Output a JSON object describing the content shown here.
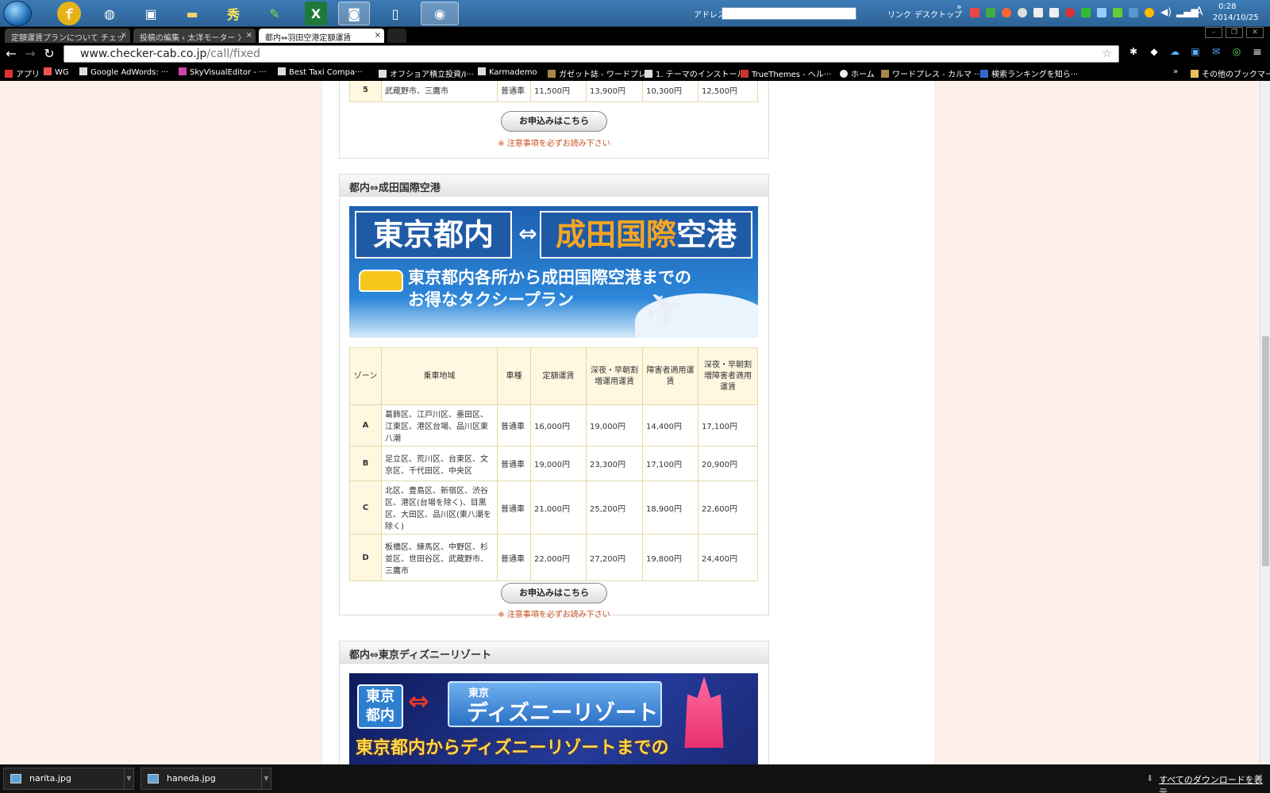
{
  "system": {
    "address_label": "アドレス",
    "links_label": "リンク",
    "desktop_label": "デスクトップ",
    "chevron": "»",
    "ime": "A",
    "clock_time": "0:28",
    "clock_date": "2014/10/25",
    "taskbar_apps": [
      "fm-icon",
      "globe-icon",
      "windows-icon",
      "folder-icon",
      "hidemaru-icon",
      "editor-icon",
      "excel-icon",
      "camera-icon",
      "document-icon",
      "chrome-icon"
    ]
  },
  "browser": {
    "tabs": [
      {
        "label": "定額運賃プランについて チェッ"
      },
      {
        "label": "投稿の編集 ‹ 太洋モーター 〉"
      },
      {
        "label": "都内⇔羽田空港定額運賃"
      }
    ],
    "url_host": "www.checker-cab.co.jp",
    "url_path": "/call/fixed",
    "bookmarks": [
      "アプリ",
      "WG",
      "Google AdWords: ···",
      "SkyVisualEditor - ···",
      "Best Taxi Compa···",
      "オフショア積立投資/I···",
      "Karmademo",
      "ガゼット誌 - ワードプレ···",
      "1. テーマのインストール",
      "TrueThemes - ヘル···",
      "ホーム",
      "ワードプレス - カルマ ···",
      "検索ランキングを知ら···"
    ],
    "bookmarks_more": "»",
    "other_bookmarks": "その他のブックマーク"
  },
  "top_table": {
    "row": {
      "zone": "5",
      "area": "武蔵野市、三鷹市",
      "car": "普通車",
      "fixed": "11,500円",
      "late": "13,900円",
      "disabled": "10,300円",
      "late_disabled": "12,500円"
    }
  },
  "apply_label": "お申込みはこちら",
  "note": "※ 注意事項を必ずお読み下さい",
  "narita": {
    "heading": "都内⇔成田国際空港",
    "banner_left": "東京都内",
    "banner_arrow": "⇔",
    "banner_right_1": "成田国際",
    "banner_right_2": "空港",
    "banner_sub1": "東京都内各所から成田国際空港までの",
    "banner_sub2": "お得なタクシープラン",
    "headers": [
      "ゾーン",
      "乗車地域",
      "車種",
      "定額運賃",
      "深夜・早朝割増運用運賃",
      "障害者適用運賃",
      "深夜・早朝割増障害者適用運賃"
    ],
    "rows": [
      {
        "zone": "A",
        "area": "葛飾区、江戸川区、墨田区、江東区、港区台場、品川区東八潮",
        "car": "普通車",
        "fixed": "16,000円",
        "late": "19,000円",
        "disabled": "14,400円",
        "late_disabled": "17,100円"
      },
      {
        "zone": "B",
        "area": "足立区、荒川区、台東区、文京区、千代田区、中央区",
        "car": "普通車",
        "fixed": "19,000円",
        "late": "23,300円",
        "disabled": "17,100円",
        "late_disabled": "20,900円"
      },
      {
        "zone": "C",
        "area": "北区、豊島区、新宿区、渋谷区、港区(台場を除く)、目黒区、大田区、品川区(東八潮を除く)",
        "car": "普通車",
        "fixed": "21,000円",
        "late": "25,200円",
        "disabled": "18,900円",
        "late_disabled": "22,600円"
      },
      {
        "zone": "D",
        "area": "板橋区、練馬区、中野区、杉並区、世田谷区、武蔵野市、三鷹市",
        "car": "普通車",
        "fixed": "22,000円",
        "late": "27,200円",
        "disabled": "19,800円",
        "late_disabled": "24,400円"
      }
    ]
  },
  "disney": {
    "heading": "都内⇔東京ディズニーリゾート",
    "banner_left_1": "東京",
    "banner_left_2": "都内",
    "banner_arrow": "⇔",
    "banner_right_small": "東京",
    "banner_right_big": "ディズニーリゾート",
    "banner_sub": "東京都内からディズニーリゾートまでの"
  },
  "downloads": {
    "items": [
      {
        "label": "narita.jpg"
      },
      {
        "label": "haneda.jpg"
      }
    ],
    "show_all": "すべてのダウンロードを表示",
    "close": "×"
  },
  "colors": {
    "accent_orange": "#f5a623",
    "note_red": "#c8501e",
    "banner_blue": "#1f5aa7"
  }
}
